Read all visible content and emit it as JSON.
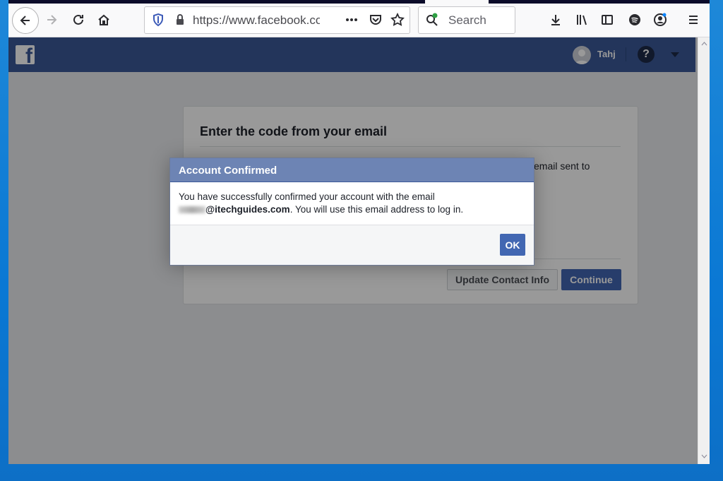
{
  "browser": {
    "url": "https://www.facebook.co",
    "search_placeholder": "Search"
  },
  "fb_header": {
    "logo": "f",
    "user_name": "Tahj",
    "help": "?"
  },
  "card": {
    "title": "Enter the code from your email",
    "body_fragment": "email sent to",
    "update_button": "Update Contact Info",
    "continue_button": "Continue"
  },
  "dialog": {
    "title": "Account Confirmed",
    "message_line1": "You have successfully confirmed your account with the email",
    "email_domain": "@itechguides.com",
    "message_line2": ". You will use this email address to log in.",
    "ok_button": "OK"
  },
  "colors": {
    "fb_blue": "#3b5998",
    "dialog_header": "#6d84b4",
    "button_blue": "#4267b2"
  }
}
